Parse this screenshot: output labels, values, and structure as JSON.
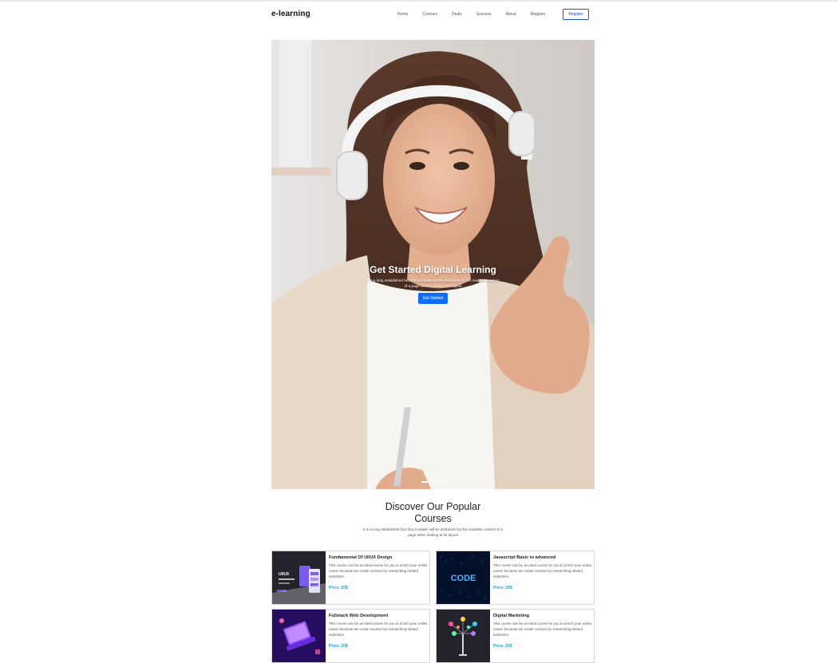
{
  "nav": {
    "brand": "e-learning",
    "links": [
      "Home",
      "Courses",
      "Deals",
      "Success",
      "About",
      "Register"
    ],
    "register_button": "Register"
  },
  "hero": {
    "title": "Get Started Digital Learning",
    "subtitle": "It is a long established fact that a reader will be distracted by the readable content of a page when looking at its layout",
    "button_label": "Get Started",
    "next_icon": "chevron-right-icon",
    "indicator_count": 3,
    "active_indicator": 0
  },
  "courses_section": {
    "title_line1": "Discover Our Popular",
    "title_line2": "Courses",
    "subtitle": "It is a long established fact that a reader will be distracted by the readable content of a page when looking at its layout"
  },
  "courses": [
    {
      "title": "Fundamental Of UI/UX Design",
      "description": "This course can be an ideal course for you to enrich your online career because we create courses by researching related industries.",
      "price": "Price: 20$",
      "thumb_text": "UI/UX"
    },
    {
      "title": "Javascript Basic to advanced",
      "description": "This course can be an ideal course for you to enrich your online career because we create courses by researching related industries.",
      "price": "Price: 20$",
      "thumb_text": "CODE"
    },
    {
      "title": "Fullstack Web Development",
      "description": "This course can be an ideal course for you to enrich your online career because we create courses by researching related industries.",
      "price": "Price: 20$",
      "thumb_text": ""
    },
    {
      "title": "Digital Marketing",
      "description": "This course can be an ideal course for you to enrich your online career because we create courses by researching related industries.",
      "price": "Price: 20$",
      "thumb_text": ""
    }
  ],
  "colors": {
    "accent_blue": "#0d6efd",
    "register_outline": "#1d4fd8",
    "price_cyan": "#1a9fd8"
  }
}
